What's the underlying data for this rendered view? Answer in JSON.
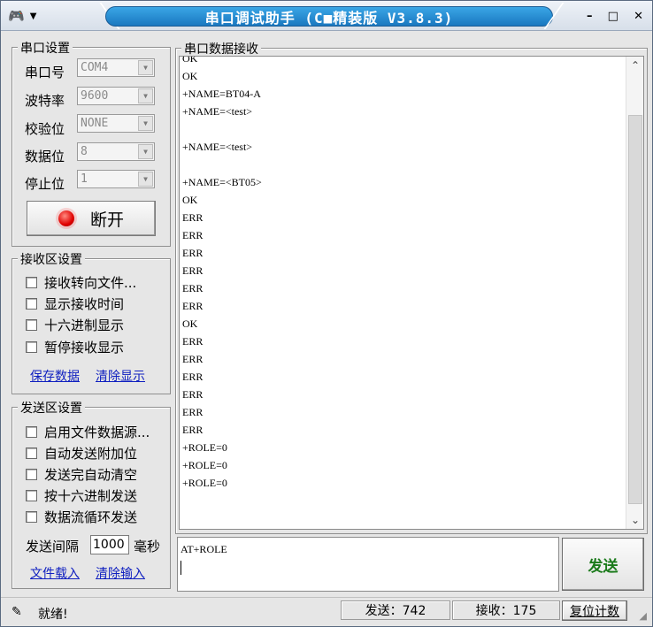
{
  "window": {
    "title": "串口调试助手 (C■精装版 V3.8.3)",
    "controls": {
      "minimize": "–",
      "maximize": "□",
      "close": "✕"
    }
  },
  "serial": {
    "group_title": "串口设置",
    "port_label": "串口号",
    "port_value": "COM4",
    "baud_label": "波特率",
    "baud_value": "9600",
    "parity_label": "校验位",
    "parity_value": "NONE",
    "databits_label": "数据位",
    "databits_value": "8",
    "stopbits_label": "停止位",
    "stopbits_value": "1",
    "connect_button": "断开"
  },
  "recv_settings": {
    "group_title": "接收区设置",
    "options": [
      "接收转向文件...",
      "显示接收时间",
      "十六进制显示",
      "暂停接收显示"
    ],
    "save_link": "保存数据",
    "clear_link": "清除显示"
  },
  "send_settings": {
    "group_title": "发送区设置",
    "options": [
      "启用文件数据源...",
      "自动发送附加位",
      "发送完自动清空",
      "按十六进制发送",
      "数据流循环发送"
    ],
    "interval_label": "发送间隔",
    "interval_value": "1000",
    "interval_unit": "毫秒",
    "load_link": "文件载入",
    "clear_link": "清除输入"
  },
  "receive_area": {
    "group_title": "串口数据接收",
    "lines": [
      "OK",
      "OK",
      "+NAME=BT04-A",
      "+NAME=<test>",
      "",
      "+NAME=<test>",
      "",
      "+NAME=<BT05>",
      "OK",
      "ERR",
      "ERR",
      "ERR",
      "ERR",
      "ERR",
      "ERR",
      "OK",
      "ERR",
      "ERR",
      "ERR",
      "ERR",
      "ERR",
      "ERR",
      "+ROLE=0",
      "+ROLE=0",
      "+ROLE=0"
    ]
  },
  "send_area": {
    "text": "AT+ROLE",
    "send_button": "发送"
  },
  "status": {
    "ready_text": "就绪!",
    "sent": "发送：742",
    "received": "接收：175",
    "reset_button": "复位计数"
  }
}
